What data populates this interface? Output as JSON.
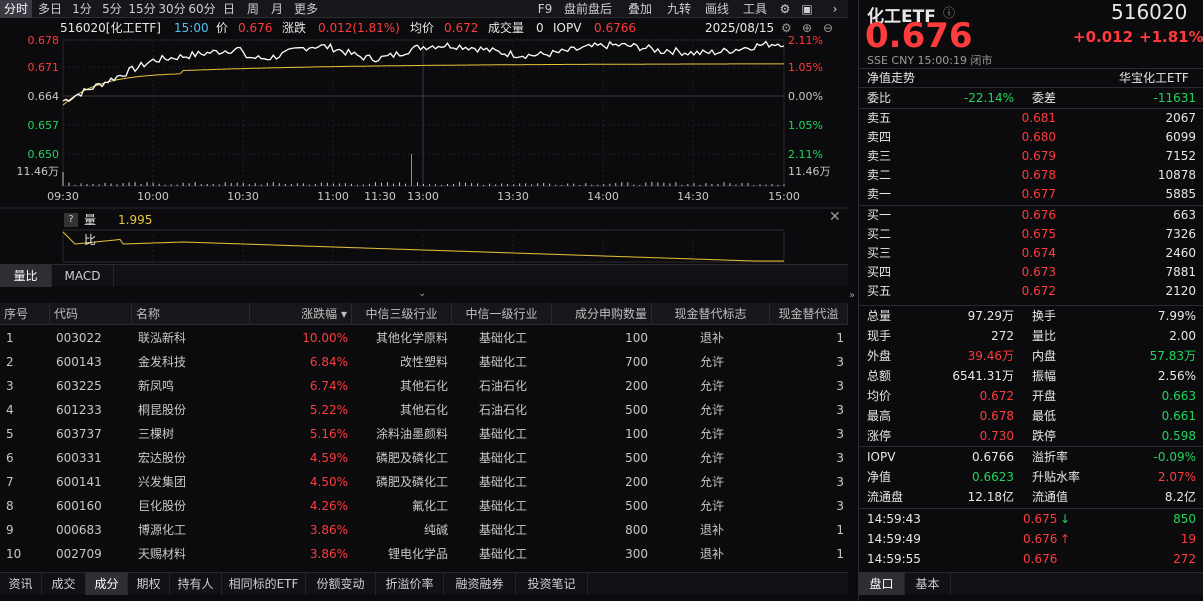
{
  "toolbar": {
    "periods": [
      "分时",
      "多日",
      "1分",
      "5分",
      "15分",
      "30分",
      "60分",
      "日",
      "周",
      "月",
      "更多"
    ],
    "active": "分时",
    "right": [
      "F9",
      "盘前盘后",
      "叠加",
      "九转",
      "画线",
      "工具"
    ]
  },
  "info": {
    "code_name": "516020[化工ETF]",
    "time": "15:00",
    "price_label": "价",
    "price": "0.676",
    "chg_label": "涨跌",
    "chg": "0.012(1.81%)",
    "avg_label": "均价",
    "avg": "0.672",
    "vol_label": "成交量",
    "vol": "0",
    "iopv_label": "IOPV",
    "iopv": "0.6766",
    "date": "2025/08/15"
  },
  "chart_data": {
    "type": "line",
    "x_labels": [
      "09:30",
      "10:00",
      "10:30",
      "11:00",
      "11:30/13:00",
      "13:30",
      "14:00",
      "14:30",
      "15:00"
    ],
    "y_left": [
      "0.678",
      "0.671",
      "0.664",
      "0.657",
      "0.650"
    ],
    "y_right": [
      "2.11%",
      "1.05%",
      "0.00%",
      "1.05%",
      "2.11%"
    ],
    "vol_label": "11.46万",
    "series": [
      {
        "name": "价",
        "color": "#ffffff"
      },
      {
        "name": "均价",
        "color": "#e8c53a"
      }
    ]
  },
  "subchart": {
    "label": "量比",
    "value": "1.995"
  },
  "subtabs": [
    "量比",
    "MACD"
  ],
  "table": {
    "headers": [
      "序号",
      "代码",
      "名称",
      "涨跌幅 ▾",
      "中信三级行业",
      "中信一级行业",
      "成分申购数量",
      "现金替代标志",
      "现金替代溢"
    ],
    "rows": [
      [
        "1",
        "003022",
        "联泓新科",
        "10.00%",
        "其他化学原料",
        "基础化工",
        "100",
        "退补",
        "1"
      ],
      [
        "2",
        "600143",
        "金发科技",
        "6.84%",
        "改性塑料",
        "基础化工",
        "700",
        "允许",
        "3"
      ],
      [
        "3",
        "603225",
        "新凤鸣",
        "6.74%",
        "其他石化",
        "石油石化",
        "200",
        "允许",
        "3"
      ],
      [
        "4",
        "601233",
        "桐昆股份",
        "5.22%",
        "其他石化",
        "石油石化",
        "500",
        "允许",
        "3"
      ],
      [
        "5",
        "603737",
        "三棵树",
        "5.16%",
        "涂料油墨颜料",
        "基础化工",
        "100",
        "允许",
        "3"
      ],
      [
        "6",
        "600331",
        "宏达股份",
        "4.59%",
        "磷肥及磷化工",
        "基础化工",
        "500",
        "允许",
        "3"
      ],
      [
        "7",
        "600141",
        "兴发集团",
        "4.50%",
        "磷肥及磷化工",
        "基础化工",
        "200",
        "允许",
        "3"
      ],
      [
        "8",
        "600160",
        "巨化股份",
        "4.26%",
        "氟化工",
        "基础化工",
        "500",
        "允许",
        "3"
      ],
      [
        "9",
        "000683",
        "博源化工",
        "3.86%",
        "纯碱",
        "基础化工",
        "800",
        "退补",
        "1"
      ],
      [
        "10",
        "002709",
        "天赐材料",
        "3.86%",
        "锂电化学品",
        "基础化工",
        "300",
        "退补",
        "1"
      ]
    ]
  },
  "bottomtabs": [
    "资讯",
    "成交",
    "成分",
    "期权",
    "持有人",
    "相同标的ETF",
    "份额变动",
    "折溢价率",
    "融资融券",
    "投资笔记"
  ],
  "bottomtab_active": "成分",
  "quote": {
    "name": "化工ETF",
    "code": "516020",
    "price": "0.676",
    "chg": "+0.012",
    "pct": "+1.81%",
    "meta": "SSE  CNY  15:00:19  闭市",
    "nav_trend": "净值走势",
    "issuer": "华宝化工ETF",
    "weibi_label": "委比",
    "weibi": "-22.14%",
    "weicha_label": "委差",
    "weicha": "-11631",
    "asks": [
      [
        "卖五",
        "0.681",
        "2067"
      ],
      [
        "卖四",
        "0.680",
        "6099"
      ],
      [
        "卖三",
        "0.679",
        "7152"
      ],
      [
        "卖二",
        "0.678",
        "10878"
      ],
      [
        "卖一",
        "0.677",
        "5885"
      ]
    ],
    "bids": [
      [
        "买一",
        "0.676",
        "663"
      ],
      [
        "买二",
        "0.675",
        "7326"
      ],
      [
        "买三",
        "0.674",
        "2460"
      ],
      [
        "买四",
        "0.673",
        "7881"
      ],
      [
        "买五",
        "0.672",
        "2120"
      ]
    ],
    "stats": [
      [
        "总量",
        "97.29万",
        "换手",
        "7.99%"
      ],
      [
        "现手",
        "272",
        "量比",
        "2.00"
      ],
      [
        "外盘",
        "39.46万",
        "内盘",
        "57.83万"
      ],
      [
        "总额",
        "6541.31万",
        "振幅",
        "2.56%"
      ],
      [
        "均价",
        "0.672",
        "开盘",
        "0.663"
      ],
      [
        "最高",
        "0.678",
        "最低",
        "0.661"
      ],
      [
        "涨停",
        "0.730",
        "跌停",
        "0.598"
      ]
    ],
    "stats2": [
      [
        "IOPV",
        "0.6766",
        "溢折率",
        "-0.09%"
      ],
      [
        "净值",
        "0.6623",
        "升贴水率",
        "2.07%"
      ],
      [
        "流通盘",
        "12.18亿",
        "流通值",
        "8.2亿"
      ]
    ],
    "ticks": [
      [
        "14:59:43",
        "0.675",
        "↓",
        "850"
      ],
      [
        "14:59:49",
        "0.676",
        "↑",
        "19"
      ],
      [
        "14:59:55",
        "0.676",
        "",
        "272"
      ]
    ],
    "tabs": [
      "盘口",
      "基本"
    ]
  },
  "colors": {
    "up": "#ff3b3b",
    "down": "#1fd65a",
    "avg": "#e8c53a"
  }
}
